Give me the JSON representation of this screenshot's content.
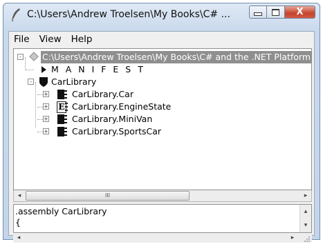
{
  "window": {
    "title": "C:\\Users\\Andrew Troelsen\\My Books\\C# ...",
    "app_icon": "quill-icon",
    "caption_buttons": {
      "close_glyph": "X"
    }
  },
  "menu": {
    "items": [
      "File",
      "View",
      "Help"
    ]
  },
  "tree": {
    "root": {
      "label": "C:\\Users\\Andrew Troelsen\\My Books\\C# and the .NET Platform",
      "expander": "-",
      "selected": true,
      "icon": "diamond-icon"
    },
    "manifest": {
      "label": "M A N I F E S T",
      "icon": "triangle-right-icon"
    },
    "assembly": {
      "label": "CarLibrary",
      "expander": "-",
      "icon": "shield-icon"
    },
    "types": [
      {
        "label": "CarLibrary.Car",
        "expander": "+",
        "icon": "class-icon"
      },
      {
        "label": "CarLibrary.EngineState",
        "expander": "+",
        "icon": "enum-icon",
        "icon_letter": "E"
      },
      {
        "label": "CarLibrary.MiniVan",
        "expander": "+",
        "icon": "class-icon"
      },
      {
        "label": "CarLibrary.SportsCar",
        "expander": "+",
        "icon": "class-icon"
      }
    ]
  },
  "scrollbar": {
    "left_arrow": "◂",
    "right_arrow": "▸",
    "thumb_grip": "III",
    "up_arrow": "▴",
    "down_arrow": "▾"
  },
  "il_text": {
    "lines": [
      ".assembly CarLibrary",
      "{"
    ]
  }
}
